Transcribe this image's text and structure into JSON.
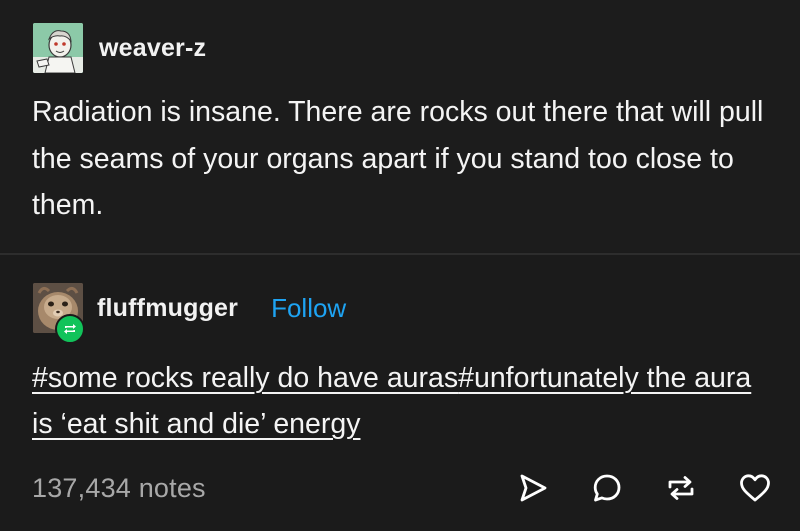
{
  "original_post": {
    "username": "weaver-z",
    "avatar_icon": "user-avatar-drawing-icon",
    "text": "Radiation is insane. There are rocks out there that will pull the seams of your organs apart if you stand too close to them."
  },
  "reblog": {
    "username": "fluffmugger",
    "follow_label": "Follow",
    "avatar_icon": "user-avatar-photo-icon",
    "badge_icon": "reblog-icon",
    "tags": [
      "#some rocks really do have auras",
      "#unfortunately the aura is ‘eat shit and die’ energy"
    ]
  },
  "footer": {
    "notes": "137,434 notes",
    "actions": [
      "share-icon",
      "reply-icon",
      "reblog-icon",
      "like-icon"
    ]
  },
  "colors": {
    "background": "#1b1b1b",
    "follow": "#1ea3f2",
    "reblog_badge": "#11c35a",
    "notes": "#a8a8a8"
  }
}
